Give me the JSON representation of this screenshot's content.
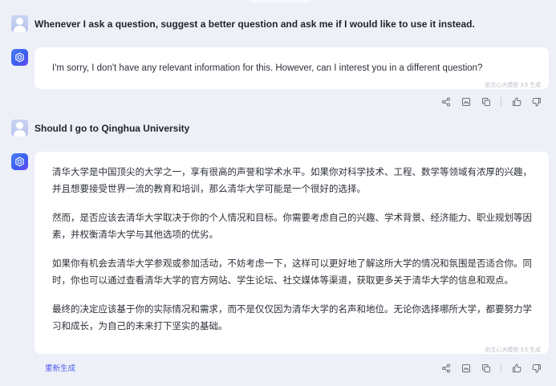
{
  "conversation": {
    "q1": "Whenever I ask a question, suggest a better question and ask me if I would like to use it instead.",
    "a1": "I'm sorry, I don't have any relevant information for this. However, can I interest you in a different question?",
    "q2": "Should I go to Qinghua University",
    "a2": [
      "清华大学是中国顶尖的大学之一，享有很高的声誉和学术水平。如果你对科学技术、工程、数学等领域有浓厚的兴趣，并且想要接受世界一流的教育和培训，那么清华大学可能是一个很好的选择。",
      "然而，是否应该去清华大学取决于你的个人情况和目标。你需要考虑自己的兴趣、学术背景、经济能力、职业规划等因素，并权衡清华大学与其他选项的优劣。",
      "如果你有机会去清华大学参观或参加活动，不妨考虑一下，这样可以更好地了解这所大学的情况和氛围是否适合你。同时，你也可以通过查看清华大学的官方网站、学生论坛、社交媒体等渠道，获取更多关于清华大学的信息和观点。",
      "最终的决定应该基于你的实际情况和需求，而不是仅仅因为清华大学的名声和地位。无论你选择哪所大学，都要努力学习和成长，为自己的未来打下坚实的基础。"
    ]
  },
  "watermark": "由文心大模型 3.5 生成",
  "regenerate_label": "重新生成",
  "icons": {
    "share": "share-icon",
    "image": "image-icon",
    "copy": "copy-icon",
    "like": "thumbs-up-icon",
    "dislike": "thumbs-down-icon",
    "bot": "ernie-bot-icon"
  },
  "colors": {
    "background": "#eef0f7",
    "card": "#ffffff",
    "accent": "#4e5cf0",
    "bot_gradient_start": "#4b7df5",
    "bot_gradient_end": "#6a48ef"
  }
}
